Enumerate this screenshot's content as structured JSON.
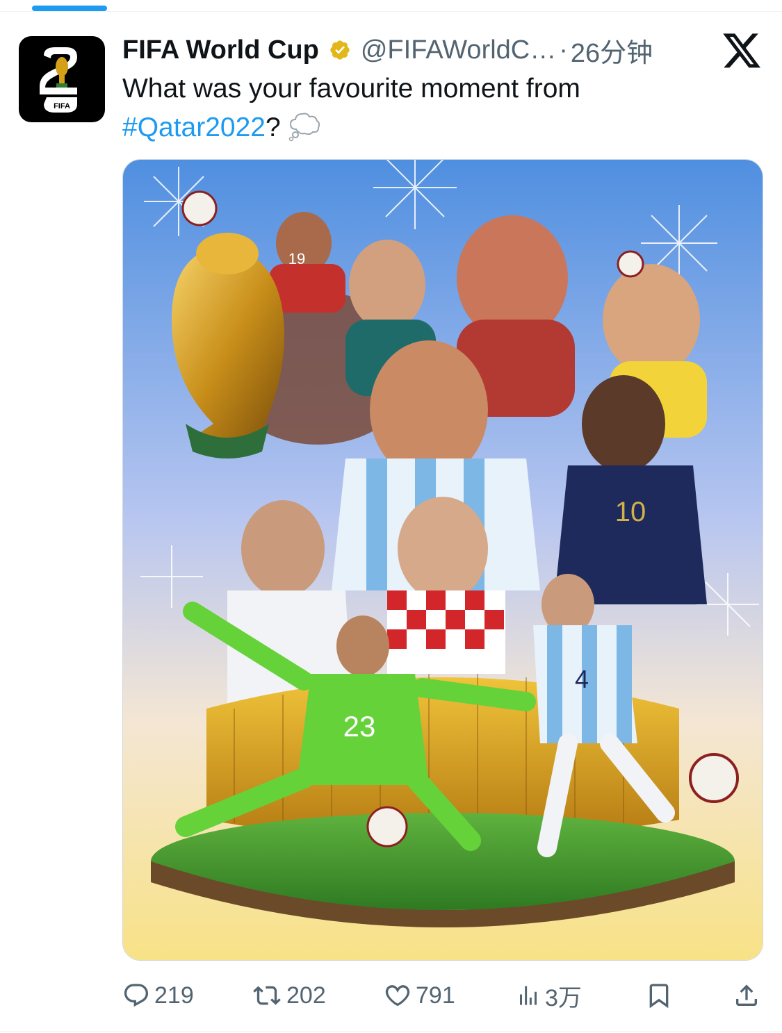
{
  "tweet": {
    "display_name": "FIFA World Cup",
    "handle": "@FIFAWorldC…",
    "separator": "·",
    "time": "26分钟",
    "text_before": "What was your favourite moment from",
    "hashtag": "#Qatar2022",
    "text_after": "?",
    "avatar_label": "FIFA"
  },
  "icons": {
    "verified": "verified-badge-icon",
    "thought_bubble": "thought-balloon-emoji",
    "platform": "x-logo-icon",
    "reply": "reply-icon",
    "retweet": "retweet-icon",
    "like": "heart-icon",
    "views": "views-icon",
    "bookmark": "bookmark-icon",
    "share": "share-icon"
  },
  "actions": {
    "replies": "219",
    "retweets": "202",
    "likes": "791",
    "views": "3万"
  },
  "image": {
    "shirt_number_goalkeeper": "23",
    "shirt_number_striker": "10",
    "shirt_number_defender": "4",
    "shirt_number_red": "19"
  },
  "colors": {
    "accent": "#1d9bf0",
    "secondary_text": "#536471",
    "primary_text": "#0f1419",
    "verified_gold": "#e2b719"
  }
}
